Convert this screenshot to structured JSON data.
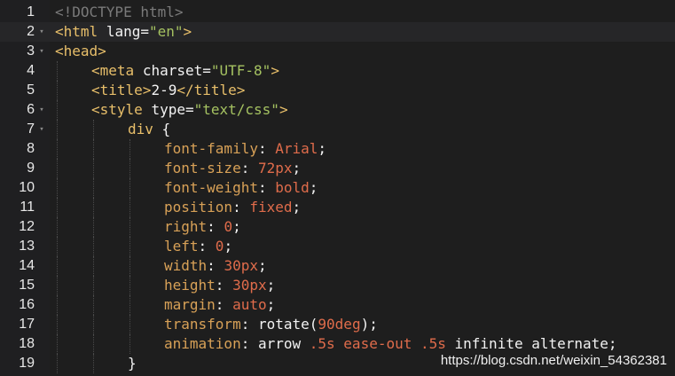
{
  "editor": {
    "lines": [
      {
        "number": "1",
        "fold": "",
        "active": false,
        "tokens": [
          {
            "t": "comment",
            "v": "<!DOCTYPE html>"
          }
        ]
      },
      {
        "number": "2",
        "fold": "▾",
        "active": true,
        "tokens": [
          {
            "t": "tag",
            "v": "<html"
          },
          {
            "t": "text",
            "v": " "
          },
          {
            "t": "attr",
            "v": "lang="
          },
          {
            "t": "str",
            "v": "\"en\""
          },
          {
            "t": "tag",
            "v": ">"
          }
        ]
      },
      {
        "number": "3",
        "fold": "▾",
        "active": false,
        "tokens": [
          {
            "t": "tag",
            "v": "<head>"
          }
        ]
      },
      {
        "number": "4",
        "fold": "",
        "active": false,
        "indent": 1,
        "tokens": [
          {
            "t": "tag",
            "v": "<meta"
          },
          {
            "t": "text",
            "v": " "
          },
          {
            "t": "attr",
            "v": "charset="
          },
          {
            "t": "str",
            "v": "\"UTF-8\""
          },
          {
            "t": "tag",
            "v": ">"
          }
        ]
      },
      {
        "number": "5",
        "fold": "",
        "active": false,
        "indent": 1,
        "tokens": [
          {
            "t": "tag",
            "v": "<title>"
          },
          {
            "t": "text",
            "v": "2-9"
          },
          {
            "t": "tag",
            "v": "</title>"
          }
        ]
      },
      {
        "number": "6",
        "fold": "▾",
        "active": false,
        "indent": 1,
        "tokens": [
          {
            "t": "tag",
            "v": "<style"
          },
          {
            "t": "text",
            "v": " "
          },
          {
            "t": "attr",
            "v": "type="
          },
          {
            "t": "str",
            "v": "\"text/css\""
          },
          {
            "t": "tag",
            "v": ">"
          }
        ]
      },
      {
        "number": "7",
        "fold": "▾",
        "active": false,
        "indent": 2,
        "tokens": [
          {
            "t": "sel",
            "v": "div"
          },
          {
            "t": "plain",
            "v": " {"
          }
        ]
      },
      {
        "number": "8",
        "fold": "",
        "active": false,
        "indent": 3,
        "tokens": [
          {
            "t": "prop",
            "v": "font-family"
          },
          {
            "t": "plain",
            "v": ": "
          },
          {
            "t": "val",
            "v": "Arial"
          },
          {
            "t": "plain",
            "v": ";"
          }
        ]
      },
      {
        "number": "9",
        "fold": "",
        "active": false,
        "indent": 3,
        "tokens": [
          {
            "t": "prop",
            "v": "font-size"
          },
          {
            "t": "plain",
            "v": ": "
          },
          {
            "t": "val",
            "v": "72px"
          },
          {
            "t": "plain",
            "v": ";"
          }
        ]
      },
      {
        "number": "10",
        "fold": "",
        "active": false,
        "indent": 3,
        "tokens": [
          {
            "t": "prop",
            "v": "font-weight"
          },
          {
            "t": "plain",
            "v": ": "
          },
          {
            "t": "val",
            "v": "bold"
          },
          {
            "t": "plain",
            "v": ";"
          }
        ]
      },
      {
        "number": "11",
        "fold": "",
        "active": false,
        "indent": 3,
        "tokens": [
          {
            "t": "prop",
            "v": "position"
          },
          {
            "t": "plain",
            "v": ": "
          },
          {
            "t": "val",
            "v": "fixed"
          },
          {
            "t": "plain",
            "v": ";"
          }
        ]
      },
      {
        "number": "12",
        "fold": "",
        "active": false,
        "indent": 3,
        "tokens": [
          {
            "t": "prop",
            "v": "right"
          },
          {
            "t": "plain",
            "v": ": "
          },
          {
            "t": "val",
            "v": "0"
          },
          {
            "t": "plain",
            "v": ";"
          }
        ]
      },
      {
        "number": "13",
        "fold": "",
        "active": false,
        "indent": 3,
        "tokens": [
          {
            "t": "prop",
            "v": "left"
          },
          {
            "t": "plain",
            "v": ": "
          },
          {
            "t": "val",
            "v": "0"
          },
          {
            "t": "plain",
            "v": ";"
          }
        ]
      },
      {
        "number": "14",
        "fold": "",
        "active": false,
        "indent": 3,
        "tokens": [
          {
            "t": "prop",
            "v": "width"
          },
          {
            "t": "plain",
            "v": ": "
          },
          {
            "t": "val",
            "v": "30px"
          },
          {
            "t": "plain",
            "v": ";"
          }
        ]
      },
      {
        "number": "15",
        "fold": "",
        "active": false,
        "indent": 3,
        "tokens": [
          {
            "t": "prop",
            "v": "height"
          },
          {
            "t": "plain",
            "v": ": "
          },
          {
            "t": "val",
            "v": "30px"
          },
          {
            "t": "plain",
            "v": ";"
          }
        ]
      },
      {
        "number": "16",
        "fold": "",
        "active": false,
        "indent": 3,
        "tokens": [
          {
            "t": "prop",
            "v": "margin"
          },
          {
            "t": "plain",
            "v": ": "
          },
          {
            "t": "val",
            "v": "auto"
          },
          {
            "t": "plain",
            "v": ";"
          }
        ]
      },
      {
        "number": "17",
        "fold": "",
        "active": false,
        "indent": 3,
        "tokens": [
          {
            "t": "prop",
            "v": "transform"
          },
          {
            "t": "plain",
            "v": ": rotate("
          },
          {
            "t": "val",
            "v": "90deg"
          },
          {
            "t": "plain",
            "v": ");"
          }
        ]
      },
      {
        "number": "18",
        "fold": "",
        "active": false,
        "indent": 3,
        "tokens": [
          {
            "t": "prop",
            "v": "animation"
          },
          {
            "t": "plain",
            "v": ": arrow "
          },
          {
            "t": "val",
            "v": ".5s ease-out .5s"
          },
          {
            "t": "plain",
            "v": " infinite alternate;"
          }
        ]
      },
      {
        "number": "19",
        "fold": "",
        "active": false,
        "indent": 2,
        "tokens": [
          {
            "t": "plain",
            "v": "}"
          }
        ]
      }
    ]
  },
  "watermark": "https://blog.csdn.net/weixin_54362381",
  "colors": {
    "background": "#1e1e1e",
    "tag": "#e8bf6a",
    "string": "#a5c261",
    "property": "#d8a157",
    "value": "#e06c4b",
    "comment": "#7a7a7a"
  }
}
